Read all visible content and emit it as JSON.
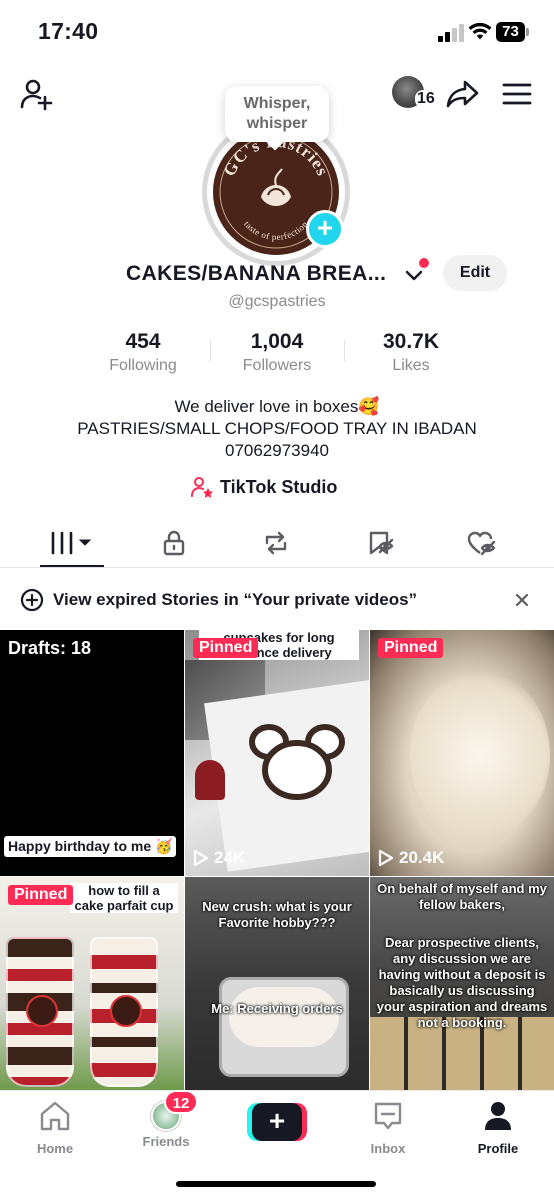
{
  "status_bar": {
    "time": "17:40",
    "battery": "73"
  },
  "top_bar": {
    "viewer_count": "16"
  },
  "profile": {
    "bubble_text": "Whisper, whisper",
    "avatar_brand_text": "GC's Pastries",
    "avatar_tagline": "taste of perfection",
    "display_name": "CAKES/BANANA BREA...",
    "edit_label": "Edit",
    "username": "@gcspastries"
  },
  "stats": [
    {
      "value": "454",
      "label": "Following"
    },
    {
      "value": "1,004",
      "label": "Followers"
    },
    {
      "value": "30.7K",
      "label": "Likes"
    }
  ],
  "bio": {
    "line1": "We deliver love in boxes🥰",
    "line2": "PASTRIES/SMALL CHOPS/FOOD TRAY IN IBADAN",
    "line3": "07062973940"
  },
  "studio_label": "TikTok Studio",
  "tabs": [
    {
      "icon": "grid-icon",
      "active": true
    },
    {
      "icon": "lock-icon"
    },
    {
      "icon": "repost-icon"
    },
    {
      "icon": "bookmark-icon"
    },
    {
      "icon": "heart-icon"
    }
  ],
  "banner": {
    "text": "View expired Stories in “Your private videos”"
  },
  "videos": [
    {
      "drafts_label": "Drafts: 18",
      "caption": "Happy birthday to me 🥳"
    },
    {
      "pinned": "Pinned",
      "overlay": "cupcakes for long distance delivery",
      "views": "24K"
    },
    {
      "pinned": "Pinned",
      "views": "20.4K"
    },
    {
      "pinned": "Pinned",
      "overlay": "how to fill a cake parfait cup"
    },
    {
      "overlay_top": "New crush:  what is your Favorite hobby???",
      "overlay_bottom": "Me: Receiving orders"
    },
    {
      "overlay_top": "On behalf of myself and my fellow bakers,",
      "overlay_bottom": "Dear prospective clients, any discussion we are having without a deposit is basically us discussing your aspiration and dreams  not a booking."
    }
  ],
  "bottom_nav": {
    "home": "Home",
    "friends": "Friends",
    "friends_badge": "12",
    "inbox": "Inbox",
    "profile": "Profile"
  },
  "colors": {
    "accent": "#fe2c55",
    "cyan": "#20d5ec",
    "text": "#161823",
    "muted": "#8a8b91"
  }
}
